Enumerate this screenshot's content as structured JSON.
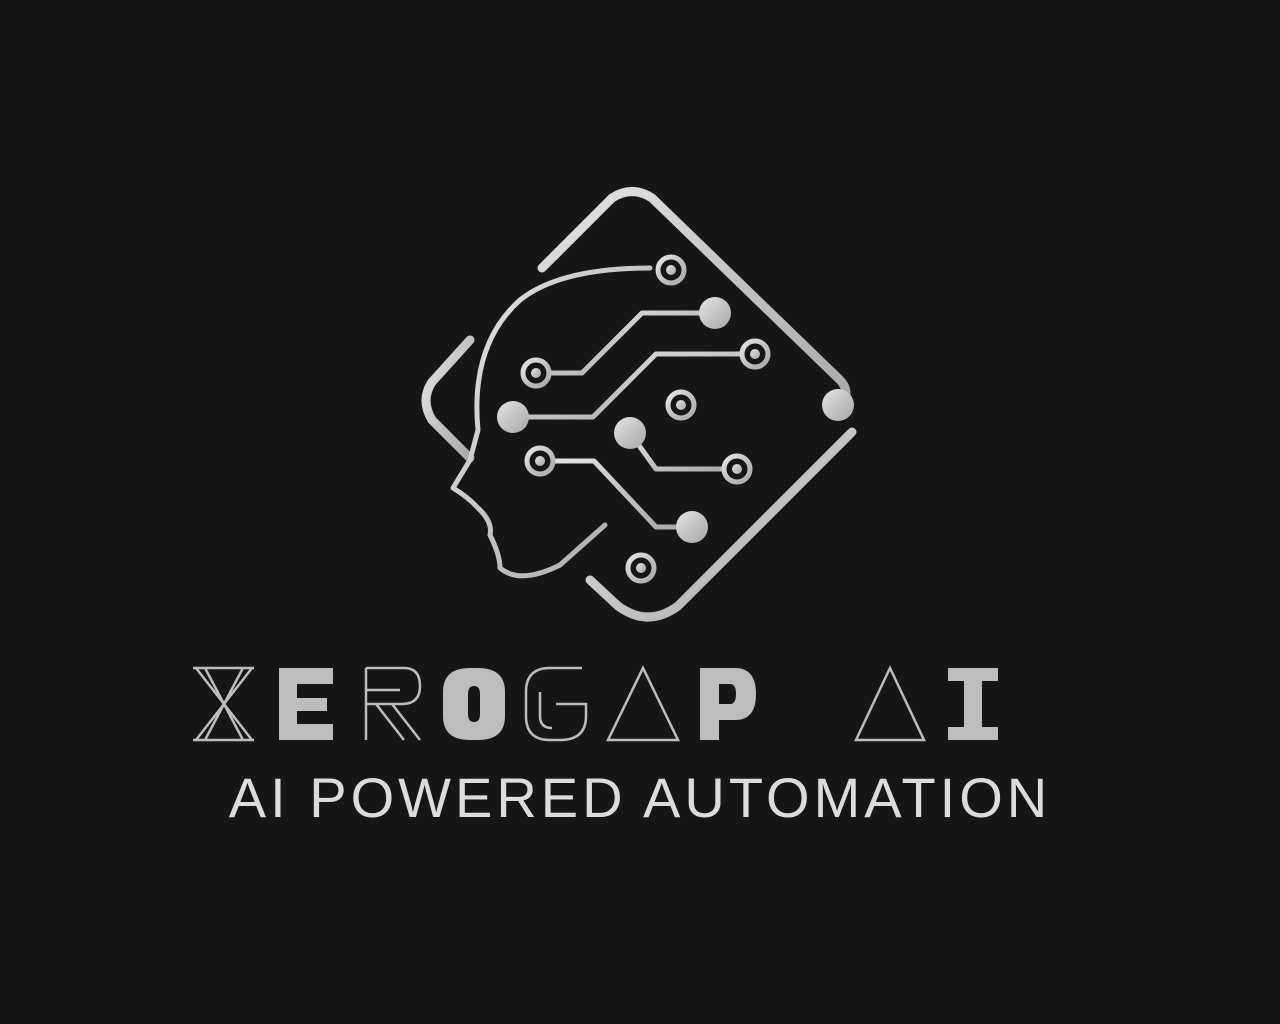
{
  "logo": {
    "brand_name": "XEROGAP AI",
    "tagline": "AI POWERED AUTOMATION",
    "icon": "ai-head-circuit-icon"
  },
  "colors": {
    "background": "#161616",
    "metal_light": "#dcdcdc",
    "metal_mid": "#bdbdbd",
    "metal_dark": "#9a9a9a"
  }
}
